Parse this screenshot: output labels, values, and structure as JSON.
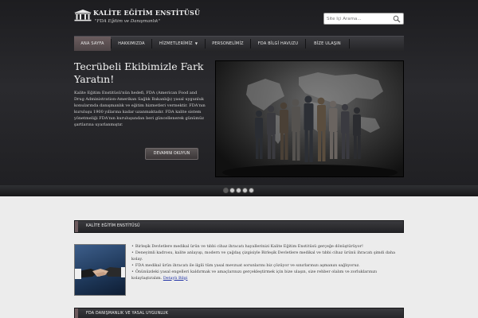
{
  "header": {
    "logo_title": "KALİTE EĞİTİM ENSTİTÜSÜ",
    "logo_tagline": "\"FDA Eğitim ve Danışmanlık\"",
    "search": {
      "placeholder": "Site İçi Arama...",
      "icon": "search-icon"
    }
  },
  "nav": {
    "items": [
      {
        "label": "ANA SAYFA"
      },
      {
        "label": "HAKKIMIZDA"
      },
      {
        "label": "HİZMETLERİMİZ",
        "caret": "▼"
      },
      {
        "label": "PERSONELİMİZ"
      },
      {
        "label": "FDA BİLGİ HAVUZU"
      },
      {
        "label": "BİZE ULAŞIN"
      }
    ],
    "active_index": 0
  },
  "slider": {
    "title": "Tecrübeli Ekibimizle Fark Yaratın!",
    "text": "Kalite Eğitim Enstitüsü'nün hedefi, FDA (American Food and Drug Administration-Amerikan Sağlık Bakanlığı) yasal uygunluk konularında danışmanlık ve eğitim hizmetleri vermektir. FDA'nın kuruluşu 1900 yıllarına kadar uzanmaktadır. FDA kalite sistem yönetmeliği FDA'nın kuruluşundan beri güncellenerek günümüz şartlarına uyarlanmıştır.",
    "button_label": "DEVAMINI OKUYUN",
    "dot_count": 5,
    "active_dot": 0
  },
  "section1": {
    "title": "KALİTE EĞİTİM ENSTİTÜSÜ",
    "bullets": [
      "Birleşik Devletlere medikal ürün ve tıbbi cihaz ihracatı hayallerinizi Kalite Eğitim Enstitüsü gerçeğe dönüştürüyor!",
      "Deneyimli kadrosu, kalite anlayışı, modern ve çağdaş çizgisiyle Birleşik Devletlere medikal ve tıbbi cihaz ürünü ihracatı şimdi daha kolay.",
      "FDA medikal ürün ihracatı ile ilgili tüm yasal mevzuat sorunlarını biz çözüyor ve sınırlarınızı aşmanızı sağlıyoruz.",
      "Önünüzdeki yasal engelleri kaldırmak ve amaçlarınızı gerçekleştirmek için bize ulaşın, size rehber olalım ve zorluklarınızı kolaylaştıralım."
    ],
    "detail_link": "Detaylı Bilgi"
  },
  "section2": {
    "title": "FDA DANIŞMANLIK VE YASAL UYGUNLUK"
  },
  "colors": {
    "header_bg": "#1d1d20",
    "nav_active": "#5b4f51",
    "section_accent": "#6d5b5e",
    "link": "#1c2ea3",
    "page_bg": "#ececec"
  }
}
